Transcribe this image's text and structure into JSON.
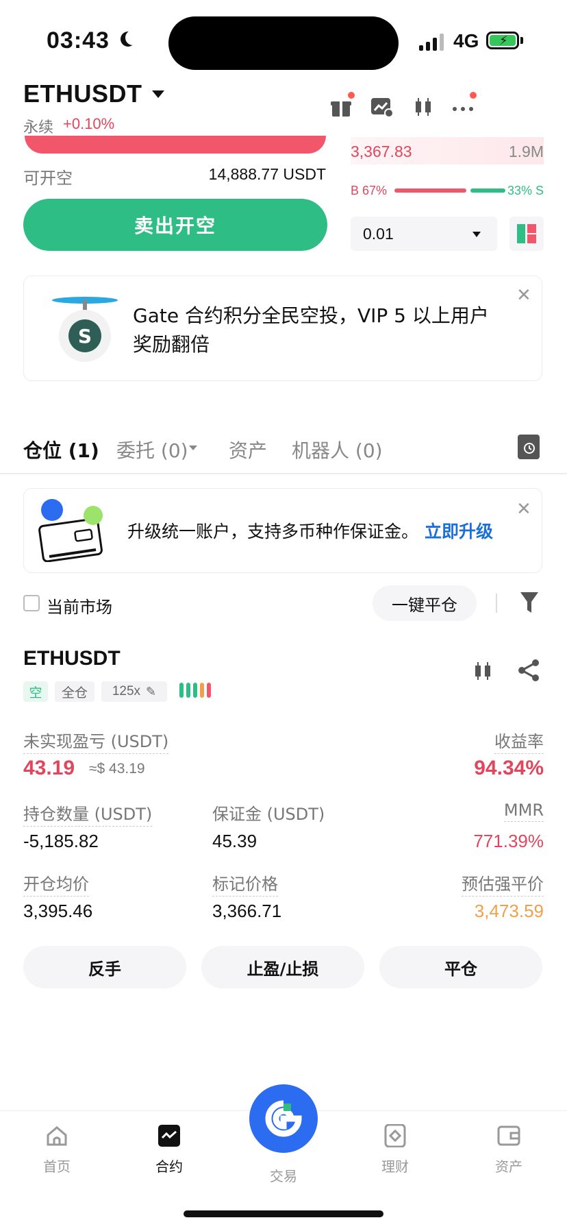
{
  "status_bar": {
    "time": "03:43",
    "network": "4G"
  },
  "header": {
    "pair": "ETHUSDT",
    "contract_type": "永续",
    "change": "+0.10%"
  },
  "order_panel": {
    "available_label": "可开空",
    "available_value": "14,888.77 USDT",
    "sell_button": "卖出开空"
  },
  "orderbook": {
    "price": "3,367.83",
    "volume": "1.9M",
    "buy_ratio_label": "B 67%",
    "sell_ratio_label": "33% S",
    "buy_ratio": 0.67,
    "quantity": "0.01"
  },
  "promo": {
    "text": "Gate 合约积分全民空投，VIP 5 以上用户奖励翻倍"
  },
  "tabs": [
    {
      "label": "仓位 (1)"
    },
    {
      "label": "委托 (0)"
    },
    {
      "label": "资产"
    },
    {
      "label": "机器人 (0)"
    }
  ],
  "upgrade": {
    "text": "升级统一账户，支持多币种作保证金。",
    "link": "立即升级"
  },
  "filter": {
    "current_market_label": "当前市场",
    "close_all_button": "一键平仓"
  },
  "position": {
    "pair": "ETHUSDT",
    "side_tag": "空",
    "margin_mode_tag": "全仓",
    "leverage_tag": "125x",
    "unrealized_pnl_label": "未实现盈亏 (USDT)",
    "unrealized_pnl": "43.19",
    "unrealized_pnl_approx": "≈$ 43.19",
    "roe_label": "收益率",
    "roe": "94.34%",
    "size_label": "持仓数量 (USDT)",
    "size": "-5,185.82",
    "margin_label": "保证金 (USDT)",
    "margin": "45.39",
    "mmr_label": "MMR",
    "mmr": "771.39%",
    "entry_price_label": "开仓均价",
    "entry_price": "3,395.46",
    "mark_price_label": "标记价格",
    "mark_price": "3,366.71",
    "liq_price_label": "预估强平价",
    "liq_price": "3,473.59",
    "buttons": {
      "reverse": "反手",
      "tp_sl": "止盈/止损",
      "close": "平仓"
    }
  },
  "bottom_nav": [
    {
      "label": "首页",
      "icon": "home-icon"
    },
    {
      "label": "合约",
      "icon": "futures-icon"
    },
    {
      "label": "交易",
      "icon": "gate-logo-icon"
    },
    {
      "label": "理财",
      "icon": "finance-icon"
    },
    {
      "label": "资产",
      "icon": "wallet-icon"
    }
  ],
  "colors": {
    "red": "#e1465d",
    "green": "#2ebd85",
    "blue": "#2c6cf0",
    "orange": "#f0a04b",
    "link": "#1a6fd9"
  }
}
